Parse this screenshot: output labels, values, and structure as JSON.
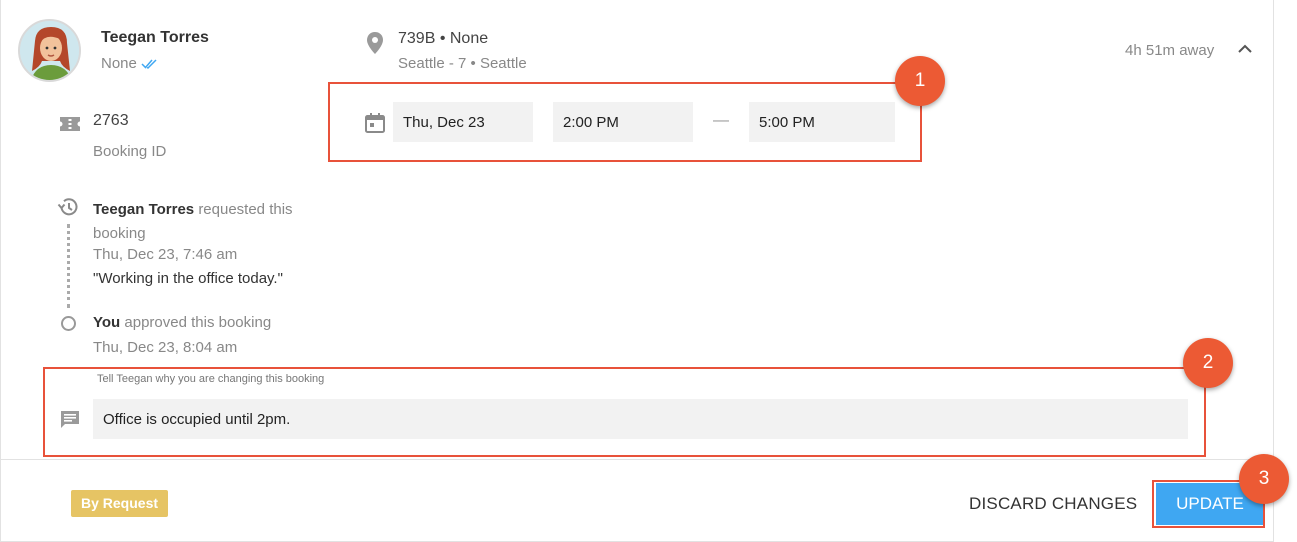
{
  "user": {
    "name": "Teegan Torres",
    "subtitle": "None"
  },
  "space": {
    "title": "739B • None",
    "location": "Seattle - 7 • Seattle"
  },
  "time_away": "4h 51m away",
  "booking": {
    "id": "2763",
    "id_label": "Booking ID"
  },
  "schedule": {
    "date": "Thu, Dec 23",
    "start": "2:00 PM",
    "separator": "—",
    "end": "5:00 PM"
  },
  "activity": [
    {
      "actor": "Teegan Torres",
      "action": "requested this booking",
      "time": "Thu, Dec 23, 7:46 am",
      "comment": "\"Working in the office today.\""
    },
    {
      "actor": "You",
      "action": "approved this booking",
      "time": "Thu, Dec 23, 8:04 am"
    }
  ],
  "reason": {
    "label": "Tell Teegan why you are changing this booking",
    "value": "Office is occupied until 2pm."
  },
  "footer": {
    "badge": "By Request",
    "discard_label": "DISCARD CHANGES",
    "update_label": "UPDATE"
  },
  "callouts": [
    "1",
    "2",
    "3"
  ],
  "colors": {
    "accent": "#3fa7f2",
    "badge": "#e6c464",
    "callout": "#ec5a34",
    "highlight_border": "#e8523a"
  }
}
